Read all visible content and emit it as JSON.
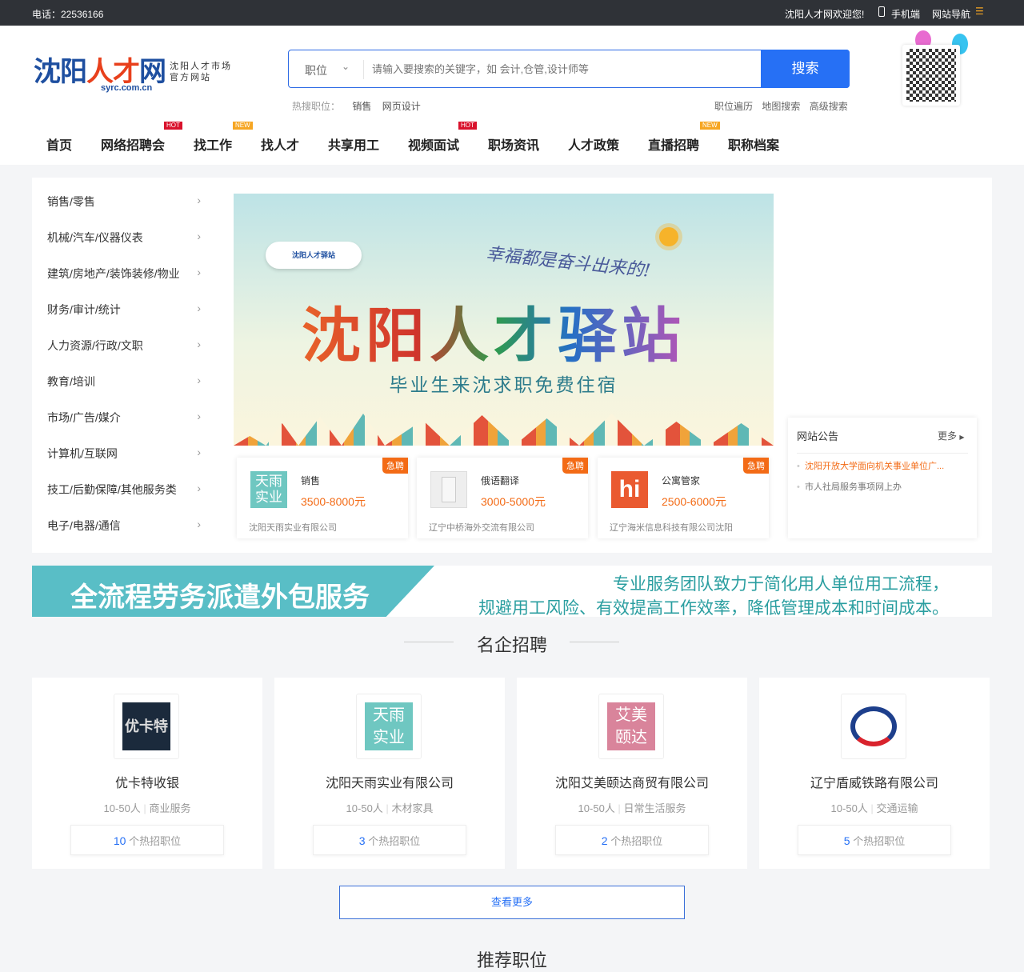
{
  "topbar": {
    "phone": "电话：22536166",
    "welcome": "沈阳人才网欢迎您!",
    "mobile": "手机端",
    "sitenav": "网站导航"
  },
  "logo": {
    "main_a": "沈阳",
    "main_b": "人才",
    "main_c": "网",
    "domain": "syrc.com.cn",
    "tag1": "沈阳人才市场",
    "tag2": "官方网站"
  },
  "search": {
    "type": "职位",
    "placeholder": "请输入要搜索的关键字，如 会计,仓管,设计师等",
    "button": "搜索",
    "hot_label": "热搜职位：",
    "hot": [
      "销售",
      "网页设计"
    ],
    "links": [
      "职位遍历",
      "地图搜索",
      "高级搜索"
    ]
  },
  "nav": [
    {
      "label": "首页"
    },
    {
      "label": "网络招聘会",
      "badge": "HOT"
    },
    {
      "label": "找工作",
      "badge": "NEW"
    },
    {
      "label": "找人才"
    },
    {
      "label": "共享用工"
    },
    {
      "label": "视频面试",
      "badge": "HOT"
    },
    {
      "label": "职场资讯"
    },
    {
      "label": "人才政策"
    },
    {
      "label": "直播招聘",
      "badge": "NEW"
    },
    {
      "label": "职称档案"
    }
  ],
  "categories": [
    "销售/零售",
    "机械/汽车/仪器仪表",
    "建筑/房地产/装饰装修/物业",
    "财务/审计/统计",
    "人力资源/行政/文职",
    "教育/培训",
    "市场/广告/媒介",
    "计算机/互联网",
    "技工/后勤保障/其他服务类",
    "电子/电器/通信"
  ],
  "banner": {
    "badge": "沈阳人才驿站",
    "slogan": "幸福都是奋斗出来的!",
    "title": "沈阳人才驿站",
    "subtitle": "毕业生来沈求职免费住宿"
  },
  "jobs": [
    {
      "tag": "急聘",
      "logo": "天雨实业",
      "title": "销售",
      "salary": "3500-8000元",
      "company": "沈阳天雨实业有限公司"
    },
    {
      "tag": "急聘",
      "logo": "",
      "title": "俄语翻译",
      "salary": "3000-5000元",
      "company": "辽宁中桥海外交流有限公司"
    },
    {
      "tag": "急聘",
      "logo": "hi",
      "title": "公寓管家",
      "salary": "2500-6000元",
      "company": "辽宁海米信息科技有限公司沈阳"
    }
  ],
  "notice": {
    "title": "网站公告",
    "more": "更多",
    "items": [
      "沈阳开放大学面向机关事业单位广...",
      "市人社局服务事项网上办"
    ]
  },
  "promo": {
    "left": "全流程劳务派遣外包服务",
    "line1": "专业服务团队致力于简化用人单位用工流程，",
    "line2": "规避用工风险、有效提高工作效率，降低管理成本和时间成本。"
  },
  "famous": {
    "title": "名企招聘",
    "more": "查看更多",
    "next_title": "推荐职位",
    "companies": [
      {
        "logo": "优卡特",
        "name": "优卡特收银",
        "size": "10-50人",
        "industry": "商业服务",
        "count": "10",
        "suffix": "个热招职位"
      },
      {
        "logo": "天雨实业",
        "name": "沈阳天雨实业有限公司",
        "size": "10-50人",
        "industry": "木材家具",
        "count": "3",
        "suffix": "个热招职位"
      },
      {
        "logo": "艾美颐达",
        "name": "沈阳艾美颐达商贸有限公司",
        "size": "10-50人",
        "industry": "日常生活服务",
        "count": "2",
        "suffix": "个热招职位"
      },
      {
        "logo": "",
        "name": "辽宁盾威铁路有限公司",
        "size": "10-50人",
        "industry": "交通运输",
        "count": "5",
        "suffix": "个热招职位"
      }
    ]
  }
}
